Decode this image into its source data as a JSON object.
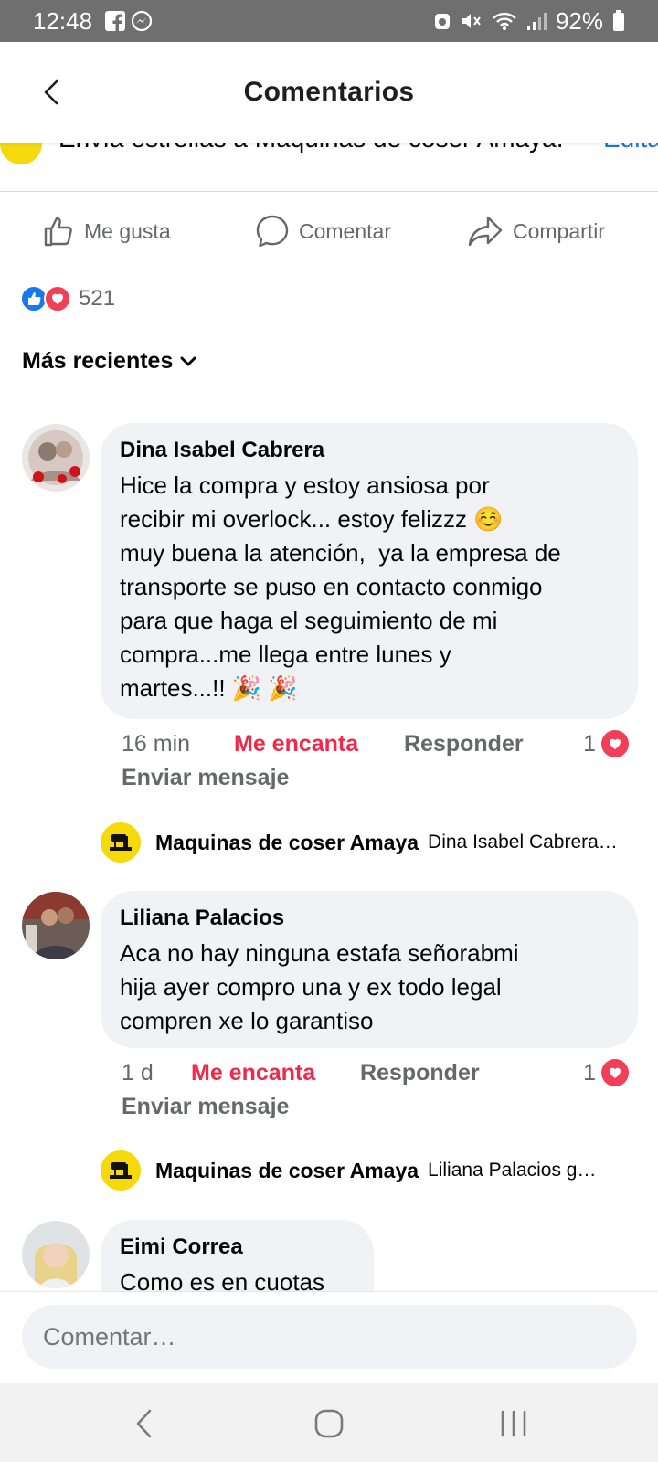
{
  "status_bar": {
    "time": "12:48",
    "battery": "92%"
  },
  "header": {
    "title": "Comentarios"
  },
  "banner": {
    "text": "Envía estrellas a Maquinas de coser Amaya.",
    "edit_label": "Edita"
  },
  "actions": {
    "like_label": "Me gusta",
    "comment_label": "Comentar",
    "share_label": "Compartir"
  },
  "reactions": {
    "count": "521"
  },
  "sort": {
    "label": "Más recientes"
  },
  "comments": [
    {
      "name": "Dina Isabel Cabrera",
      "body": "Hice la compra y estoy ansiosa por\nrecibir mi overlock... estoy felizzz ☺️\nmuy buena la atención,  ya la empresa de\ntransporte se puso en contacto conmigo\npara que haga el seguimiento de mi\ncompra...me llega entre lunes y\nmartes...!! 🎉 🎉",
      "time": "16 min",
      "love_label": "Me encanta",
      "reply_label": "Responder",
      "message_label": "Enviar mensaje",
      "reactions": "1",
      "reply": {
        "name": "Maquinas de coser Amaya",
        "text": "Dina Isabel Cabrera…"
      }
    },
    {
      "name": "Liliana Palacios",
      "body": "Aca no hay ninguna estafa señorabmi\nhija ayer compro una y ex todo legal\ncompren xe lo garantiso",
      "time": "1 d",
      "love_label": "Me encanta",
      "reply_label": "Responder",
      "message_label": "Enviar mensaje",
      "reactions": "1",
      "reply": {
        "name": "Maquinas de coser Amaya",
        "text": "Liliana Palacios g…"
      }
    },
    {
      "name": "Eimi Correa",
      "body": "Como es en cuotas"
    }
  ],
  "composer": {
    "placeholder": "Comentar…"
  },
  "colors": {
    "love": "#f02849",
    "brand_blue": "#1877f2",
    "bubble_bg": "#f0f2f5",
    "page_logo_yellow": "#f5d90a"
  },
  "icons": [
    "facebook-icon",
    "messenger-icon",
    "mute-icon",
    "wifi-icon",
    "signal-icon",
    "battery-icon",
    "back-icon",
    "like-icon",
    "comment-icon",
    "share-icon",
    "chevron-down-icon",
    "heart-icon"
  ]
}
